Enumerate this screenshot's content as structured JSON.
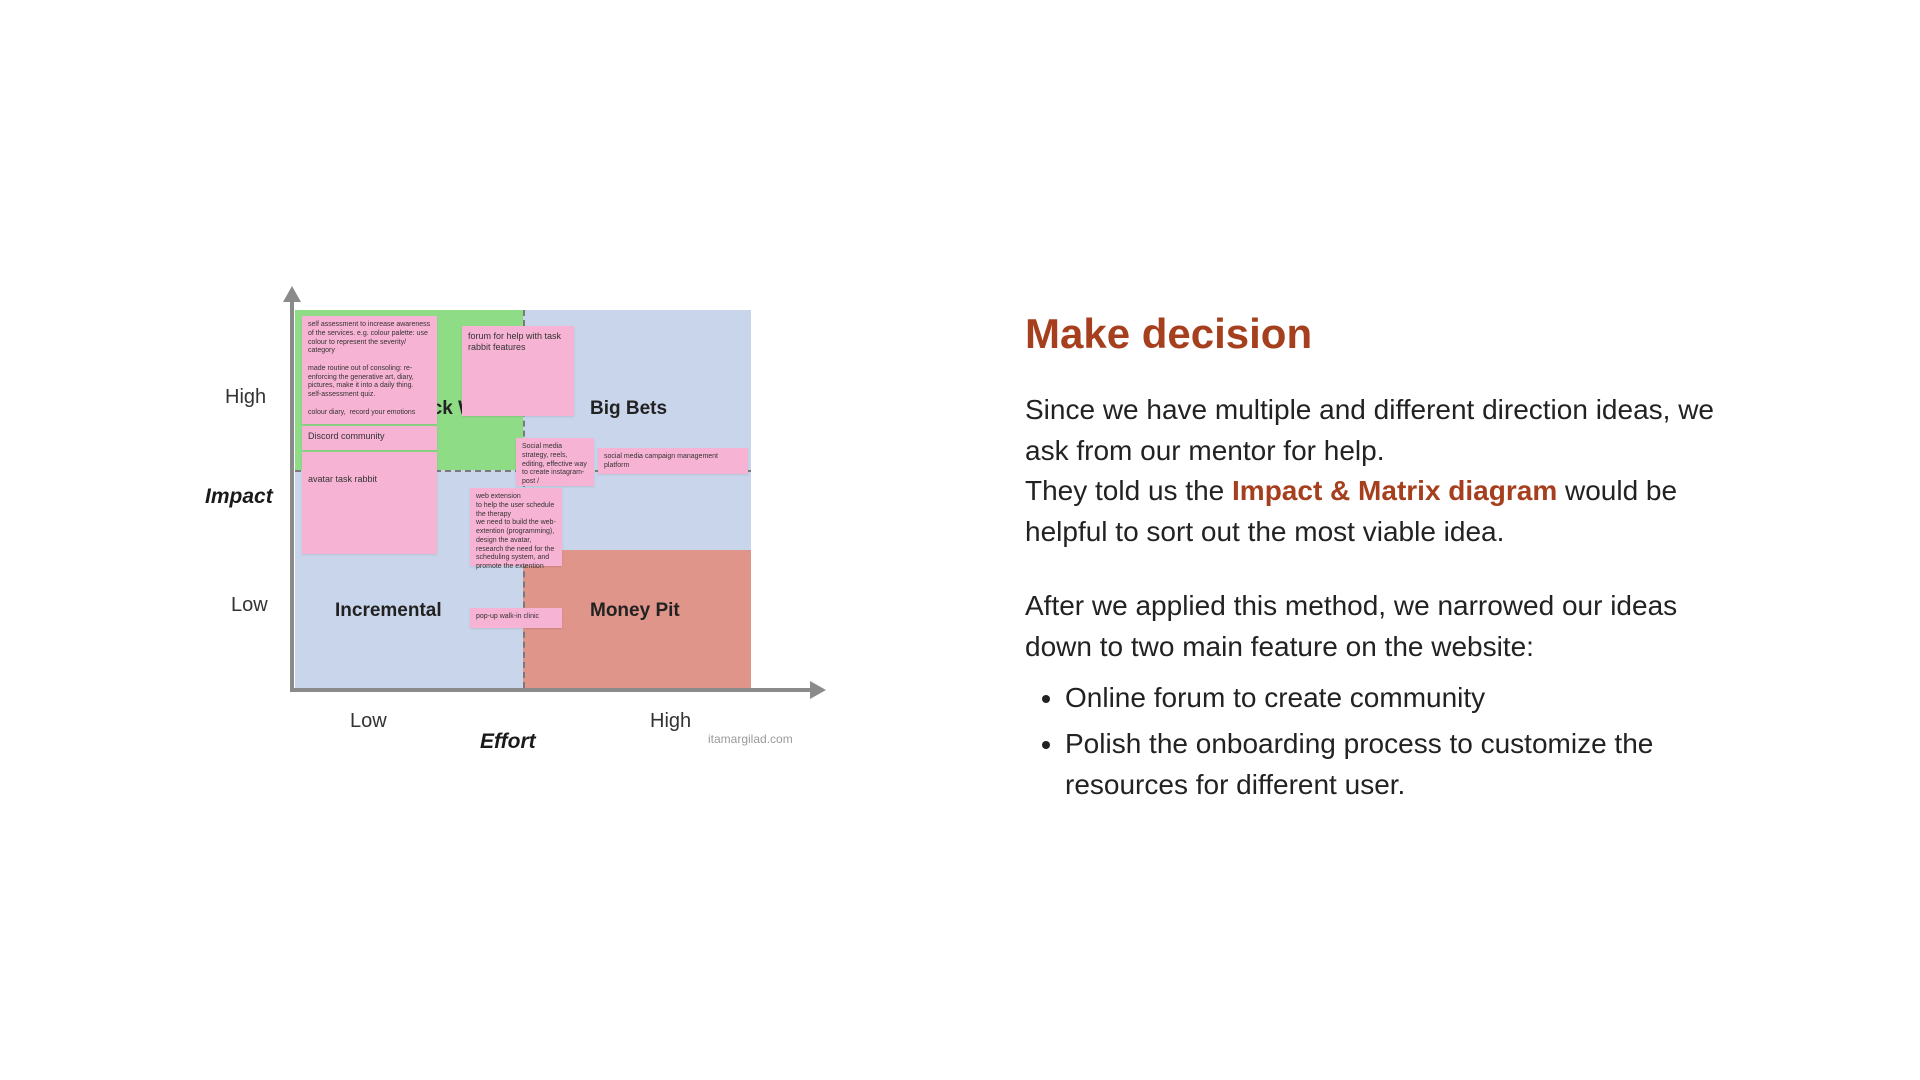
{
  "diagram": {
    "y_axis_label": "Impact",
    "x_axis_label": "Effort",
    "y_high": "High",
    "y_low": "Low",
    "x_low": "Low",
    "x_high": "High",
    "quadrants": {
      "top_left": "Quick Wins",
      "top_right": "Big Bets",
      "bottom_left": "Incremental",
      "bottom_right": "Money Pit"
    },
    "attribution": "itamargilad.com",
    "notes": {
      "n1": "self assessment to increase awareness of the services. e.g. colour palette: use colour to represent the severity/ category\n\nmade routine out of consoling: re-enforcing the generative art, diary, pictures, make it into a daily thing.\nself-assessment quiz.\n\ncolour diary,  record your emotions",
      "n2": "forum for help with task rabbit features",
      "n3": "Discord community",
      "n4": "avatar task rabbit",
      "n5": "Social media strategy, reels, editing, effective way to create instagram-post /",
      "n6": "social media campaign management platform",
      "n7": "web extension\nto help the user schedule the therapy\nwe need to build the web-extention (programming), design the avatar, research the need for the scheduling system, and promote the extention",
      "n8": "pop-up walk-in clinic"
    }
  },
  "right": {
    "heading": "Make decision",
    "p1a": "Since we have multiple and different direction ideas, we ask from our mentor for help.",
    "p1b_pre": "They told us the ",
    "p1b_hl": "Impact & Matrix diagram",
    "p1b_post": " would be helpful to sort out the most viable idea.",
    "p2": "After we applied this method, we narrowed our ideas down to two main feature on the website:",
    "bullets": [
      "Online forum to create community",
      "Polish the onboarding process to customize the resources for different user."
    ]
  }
}
